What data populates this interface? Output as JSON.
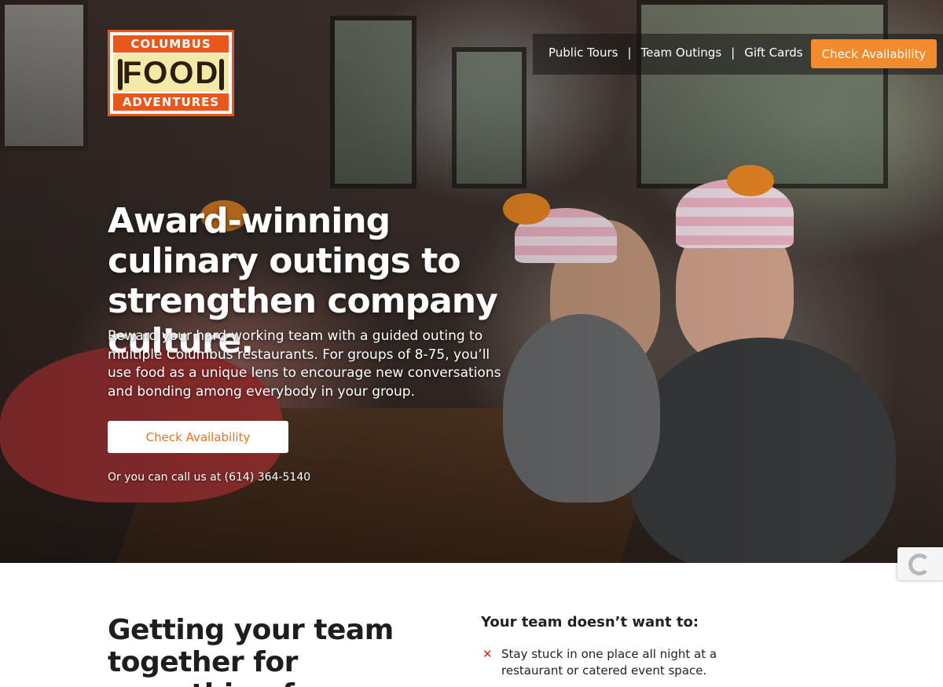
{
  "brand": {
    "logo_top": "COLUMBUS",
    "logo_mid": "FOOD",
    "logo_bottom": "ADVENTURES"
  },
  "nav": {
    "links": [
      "Public Tours",
      "Team Outings",
      "Gift Cards"
    ],
    "separator": "|",
    "cta": "Check Availability"
  },
  "hero": {
    "title": "Award-winning culinary outings to strengthen company culture.",
    "subtitle": "Reward your hard-working team with a guided outing to multiple Columbus restaurants. For groups of 8-75, you’ll use food as a unique lens to encourage new conversations and bonding among everybody in your group.",
    "cta": "Check Availability",
    "phone_prefix": "Or you can call us at",
    "phone": "(614) 364-5140"
  },
  "section": {
    "heading": "Getting your team together for something fun",
    "list_heading": "Your team doesn’t want to:",
    "list_items": [
      "Stay stuck in one place all night at a restaurant or catered event space."
    ],
    "bullet_icon": "x-icon"
  },
  "colors": {
    "accent": "#f28a2e",
    "logo_orange": "#e8571c",
    "x_red": "#e02424"
  }
}
